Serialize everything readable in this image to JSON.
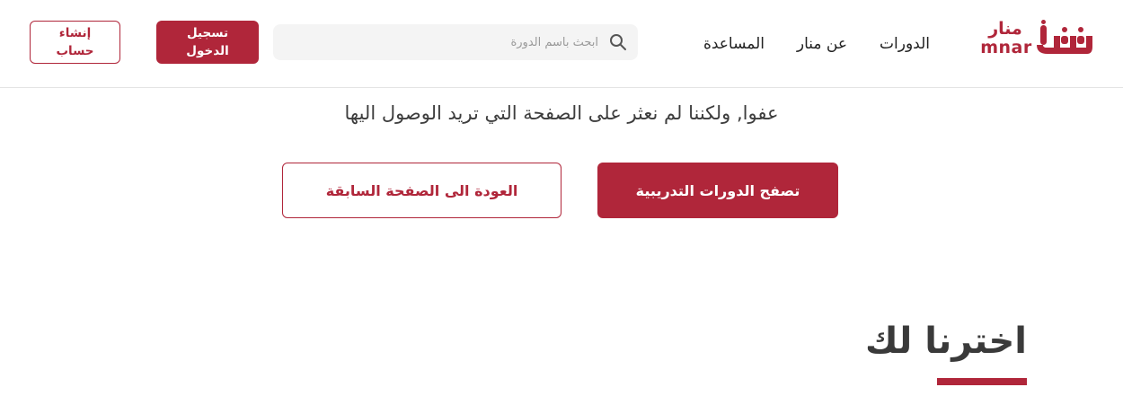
{
  "brand": {
    "name_ar": "منار",
    "name_en": "mnar",
    "color": "#b0263a"
  },
  "nav": {
    "courses": "الدورات",
    "about": "عن منار",
    "help": "المساعدة"
  },
  "search": {
    "placeholder": "ابحث باسم الدورة",
    "value": "",
    "icon": "search-icon"
  },
  "auth": {
    "login_label": "تسجيل الدخول",
    "register_label": "إنشاء حساب"
  },
  "error": {
    "message": "عفوا, ولكننا لم نعثر على الصفحة التي تريد الوصول اليها",
    "browse_courses_label": "تصفح الدورات التدريبية",
    "go_back_label": "العودة الى الصفحة السابقة"
  },
  "recommended": {
    "title": "اخترنا لك"
  }
}
